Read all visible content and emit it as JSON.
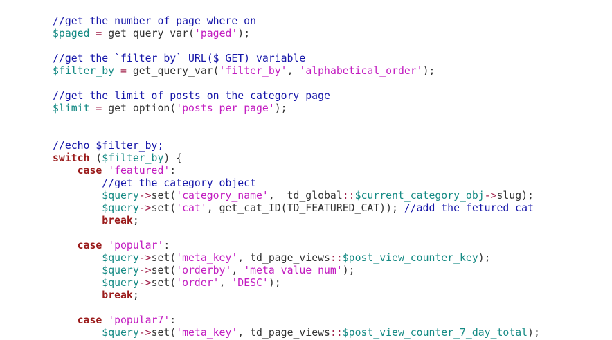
{
  "editor": {
    "colors": {
      "background": "#ffffff",
      "comment": "#1515a8",
      "variable": "#158a84",
      "string": "#c21cc0",
      "keyword": "#9b1c1c",
      "operator": "#a0204a",
      "text": "#333333"
    },
    "lines": [
      [
        {
          "c": "comment",
          "t": "//get the number of page where on"
        }
      ],
      [
        {
          "c": "var",
          "t": "$paged"
        },
        {
          "c": "plain",
          "t": " "
        },
        {
          "c": "op",
          "t": "="
        },
        {
          "c": "plain",
          "t": " get_query_var("
        },
        {
          "c": "str",
          "t": "'paged'"
        },
        {
          "c": "plain",
          "t": ");"
        }
      ],
      [],
      [
        {
          "c": "comment",
          "t": "//get the `filter_by` URL($_GET) variable"
        }
      ],
      [
        {
          "c": "var",
          "t": "$filter_by"
        },
        {
          "c": "plain",
          "t": " "
        },
        {
          "c": "op",
          "t": "="
        },
        {
          "c": "plain",
          "t": " get_query_var("
        },
        {
          "c": "str",
          "t": "'filter_by'"
        },
        {
          "c": "plain",
          "t": ", "
        },
        {
          "c": "str",
          "t": "'alphabetical_order'"
        },
        {
          "c": "plain",
          "t": ");"
        }
      ],
      [],
      [
        {
          "c": "comment",
          "t": "//get the limit of posts on the category page"
        }
      ],
      [
        {
          "c": "var",
          "t": "$limit"
        },
        {
          "c": "plain",
          "t": " "
        },
        {
          "c": "op",
          "t": "="
        },
        {
          "c": "plain",
          "t": " get_option("
        },
        {
          "c": "str",
          "t": "'posts_per_page'"
        },
        {
          "c": "plain",
          "t": ");"
        }
      ],
      [],
      [],
      [
        {
          "c": "comment",
          "t": "//echo $filter_by;"
        }
      ],
      [
        {
          "c": "kw",
          "t": "switch"
        },
        {
          "c": "plain",
          "t": " ("
        },
        {
          "c": "var",
          "t": "$filter_by"
        },
        {
          "c": "plain",
          "t": ") {"
        }
      ],
      [
        {
          "c": "plain",
          "t": "    "
        },
        {
          "c": "kw",
          "t": "case"
        },
        {
          "c": "plain",
          "t": " "
        },
        {
          "c": "str",
          "t": "'featured'"
        },
        {
          "c": "plain",
          "t": ":"
        }
      ],
      [
        {
          "c": "plain",
          "t": "        "
        },
        {
          "c": "comment",
          "t": "//get the category object"
        }
      ],
      [
        {
          "c": "plain",
          "t": "        "
        },
        {
          "c": "var",
          "t": "$query"
        },
        {
          "c": "op",
          "t": "->"
        },
        {
          "c": "plain",
          "t": "set("
        },
        {
          "c": "str",
          "t": "'category_name'"
        },
        {
          "c": "plain",
          "t": ",  td_global"
        },
        {
          "c": "op",
          "t": "::"
        },
        {
          "c": "var",
          "t": "$current_category_obj"
        },
        {
          "c": "op",
          "t": "->"
        },
        {
          "c": "plain",
          "t": "slug);"
        }
      ],
      [
        {
          "c": "plain",
          "t": "        "
        },
        {
          "c": "var",
          "t": "$query"
        },
        {
          "c": "op",
          "t": "->"
        },
        {
          "c": "plain",
          "t": "set("
        },
        {
          "c": "str",
          "t": "'cat'"
        },
        {
          "c": "plain",
          "t": ", get_cat_ID(TD_FEATURED_CAT)); "
        },
        {
          "c": "comment",
          "t": "//add the fetured cat"
        }
      ],
      [
        {
          "c": "plain",
          "t": "        "
        },
        {
          "c": "kw",
          "t": "break"
        },
        {
          "c": "plain",
          "t": ";"
        }
      ],
      [],
      [
        {
          "c": "plain",
          "t": "    "
        },
        {
          "c": "kw",
          "t": "case"
        },
        {
          "c": "plain",
          "t": " "
        },
        {
          "c": "str",
          "t": "'popular'"
        },
        {
          "c": "plain",
          "t": ":"
        }
      ],
      [
        {
          "c": "plain",
          "t": "        "
        },
        {
          "c": "var",
          "t": "$query"
        },
        {
          "c": "op",
          "t": "->"
        },
        {
          "c": "plain",
          "t": "set("
        },
        {
          "c": "str",
          "t": "'meta_key'"
        },
        {
          "c": "plain",
          "t": ", td_page_views"
        },
        {
          "c": "op",
          "t": "::"
        },
        {
          "c": "var",
          "t": "$post_view_counter_key"
        },
        {
          "c": "plain",
          "t": ");"
        }
      ],
      [
        {
          "c": "plain",
          "t": "        "
        },
        {
          "c": "var",
          "t": "$query"
        },
        {
          "c": "op",
          "t": "->"
        },
        {
          "c": "plain",
          "t": "set("
        },
        {
          "c": "str",
          "t": "'orderby'"
        },
        {
          "c": "plain",
          "t": ", "
        },
        {
          "c": "str",
          "t": "'meta_value_num'"
        },
        {
          "c": "plain",
          "t": ");"
        }
      ],
      [
        {
          "c": "plain",
          "t": "        "
        },
        {
          "c": "var",
          "t": "$query"
        },
        {
          "c": "op",
          "t": "->"
        },
        {
          "c": "plain",
          "t": "set("
        },
        {
          "c": "str",
          "t": "'order'"
        },
        {
          "c": "plain",
          "t": ", "
        },
        {
          "c": "str",
          "t": "'DESC'"
        },
        {
          "c": "plain",
          "t": ");"
        }
      ],
      [
        {
          "c": "plain",
          "t": "        "
        },
        {
          "c": "kw",
          "t": "break"
        },
        {
          "c": "plain",
          "t": ";"
        }
      ],
      [],
      [
        {
          "c": "plain",
          "t": "    "
        },
        {
          "c": "kw",
          "t": "case"
        },
        {
          "c": "plain",
          "t": " "
        },
        {
          "c": "str",
          "t": "'popular7'"
        },
        {
          "c": "plain",
          "t": ":"
        }
      ],
      [
        {
          "c": "plain",
          "t": "        "
        },
        {
          "c": "var",
          "t": "$query"
        },
        {
          "c": "op",
          "t": "->"
        },
        {
          "c": "plain",
          "t": "set("
        },
        {
          "c": "str",
          "t": "'meta_key'"
        },
        {
          "c": "plain",
          "t": ", td_page_views"
        },
        {
          "c": "op",
          "t": "::"
        },
        {
          "c": "var",
          "t": "$post_view_counter_7_day_total"
        },
        {
          "c": "plain",
          "t": ");"
        }
      ]
    ]
  }
}
